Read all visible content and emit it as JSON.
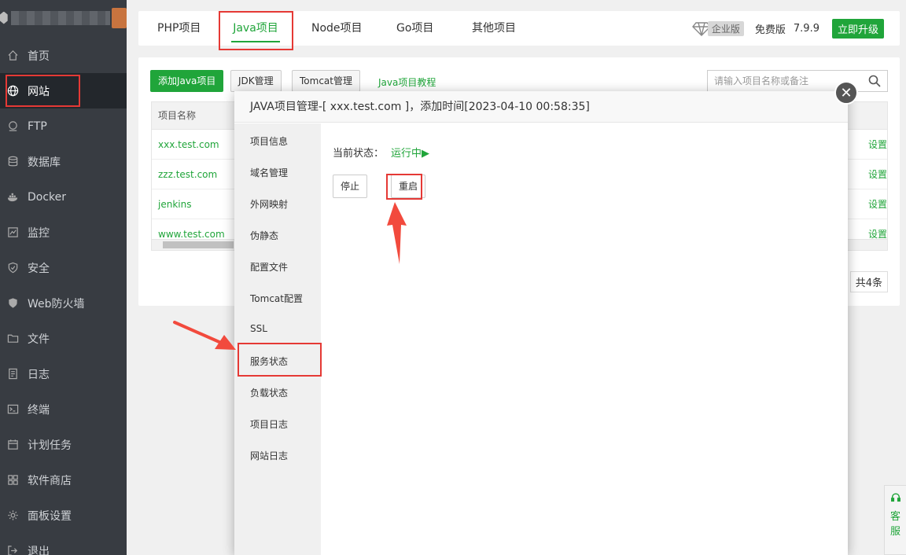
{
  "sidebar": {
    "items": [
      {
        "label": "首页",
        "icon": "home-icon"
      },
      {
        "label": "网站",
        "icon": "globe-icon"
      },
      {
        "label": "FTP",
        "icon": "ftp-icon"
      },
      {
        "label": "数据库",
        "icon": "database-icon"
      },
      {
        "label": "Docker",
        "icon": "docker-icon"
      },
      {
        "label": "监控",
        "icon": "monitor-icon"
      },
      {
        "label": "安全",
        "icon": "shield-icon"
      },
      {
        "label": "Web防火墙",
        "icon": "firewall-icon"
      },
      {
        "label": "文件",
        "icon": "folder-icon"
      },
      {
        "label": "日志",
        "icon": "log-icon"
      },
      {
        "label": "终端",
        "icon": "terminal-icon"
      },
      {
        "label": "计划任务",
        "icon": "calendar-icon"
      },
      {
        "label": "软件商店",
        "icon": "grid-icon"
      },
      {
        "label": "面板设置",
        "icon": "gear-icon"
      },
      {
        "label": "退出",
        "icon": "logout-icon"
      }
    ]
  },
  "tabs": [
    "PHP项目",
    "Java项目",
    "Node项目",
    "Go项目",
    "其他项目"
  ],
  "edition": {
    "enterprise": "企业版",
    "free": "免费版",
    "version": "7.9.9",
    "upgrade": "立即升级"
  },
  "toolbar": {
    "add": "添加Java项目",
    "jdk": "JDK管理",
    "tomcat": "Tomcat管理",
    "tutorial": "Java项目教程"
  },
  "search": {
    "placeholder": "请输入项目名称或备注"
  },
  "table": {
    "header": "项目名称",
    "rows": [
      "xxx.test.com",
      "zzz.test.com",
      "jenkins",
      "www.test.com"
    ],
    "action": "设置"
  },
  "total": "共4条",
  "modal": {
    "title": "JAVA项目管理-[ xxx.test.com ]，添加时间[2023-04-10 00:58:35]",
    "nav": [
      "项目信息",
      "域名管理",
      "外网映射",
      "伪静态",
      "配置文件",
      "Tomcat配置",
      "SSL",
      "服务状态",
      "负载状态",
      "项目日志",
      "网站日志"
    ],
    "status_label": "当前状态：",
    "status_value": "运行中▶",
    "stop": "停止",
    "restart": "重启"
  },
  "support": {
    "label_1": "客",
    "label_2": "服"
  },
  "colors": {
    "accent": "#20a53a",
    "highlight": "#e53935",
    "sidebar_bg": "#383c42"
  }
}
